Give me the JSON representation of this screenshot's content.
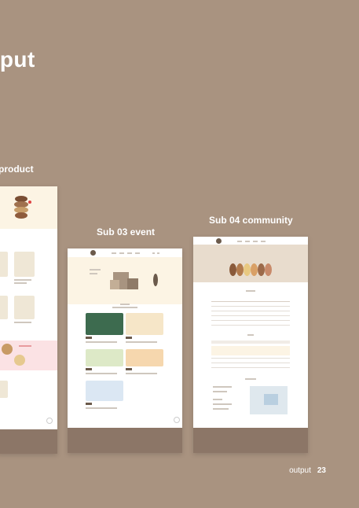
{
  "heading": "tput",
  "sections": [
    {
      "label": "product"
    },
    {
      "label": "Sub 03 event"
    },
    {
      "label": "Sub 04 community"
    }
  ],
  "pagination": {
    "label": "output",
    "number": "23"
  },
  "colors": {
    "background": "#a99380",
    "footer": "#8c7667",
    "hero": "#fcf4e4",
    "accent": "#6b5a4b"
  }
}
